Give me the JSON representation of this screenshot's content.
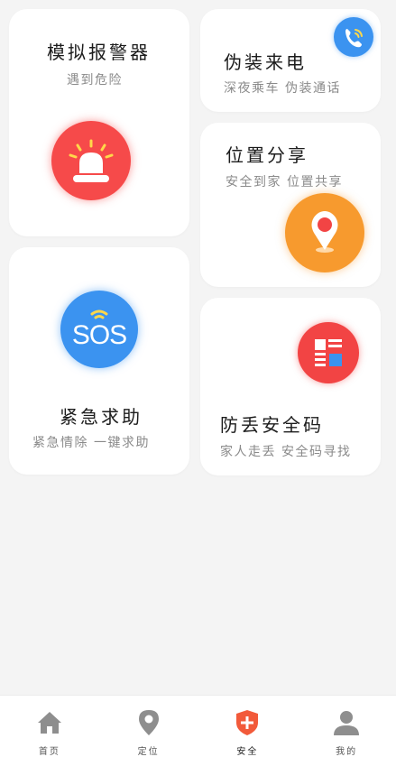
{
  "cards": {
    "alarm": {
      "title": "模拟报警器",
      "subtitle": "遇到危险"
    },
    "fake_call": {
      "title": "伪装来电",
      "subtitle": "深夜乘车 伪装通话"
    },
    "location_share": {
      "title": "位置分享",
      "subtitle": "安全到家 位置共享"
    },
    "sos": {
      "title": "紧急求助",
      "subtitle": "紧急情除 一键求助",
      "badge": "SOS"
    },
    "anti_loss": {
      "title": "防丢安全码",
      "subtitle": "家人走丢 安全码寻找"
    }
  },
  "bottom_nav": {
    "items": [
      {
        "label": "首页",
        "icon": "home-icon"
      },
      {
        "label": "定位",
        "icon": "location-pin-icon"
      },
      {
        "label": "安全",
        "icon": "safety-shield-icon",
        "active": true
      },
      {
        "label": "我的",
        "icon": "user-icon"
      }
    ]
  },
  "colors": {
    "alarm_red": "#f64a4a",
    "phone_blue": "#3b93f0",
    "location_orange": "#f79a2e",
    "sos_blue": "#3b93f0",
    "qr_red": "#f24444",
    "nav_gray": "#8e8e8e",
    "nav_active": "#f25a3a"
  }
}
